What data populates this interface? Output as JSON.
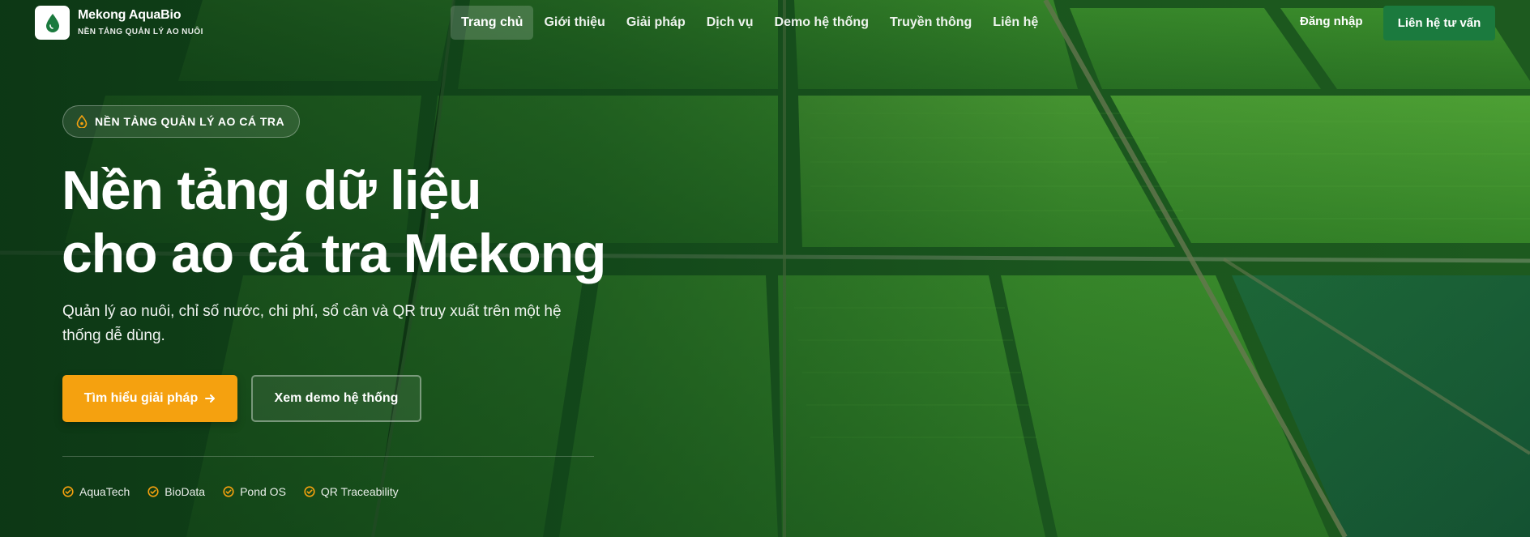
{
  "brand": {
    "name": "Mekong AquaBio",
    "tagline": "NỀN TẢNG QUẢN LÝ AO NUÔI",
    "logo_icon": "water-drop-icon"
  },
  "nav": {
    "items": [
      {
        "label": "Trang chủ",
        "active": true
      },
      {
        "label": "Giới thiệu"
      },
      {
        "label": "Giải pháp"
      },
      {
        "label": "Dịch vụ"
      },
      {
        "label": "Demo hệ thống"
      },
      {
        "label": "Truyền thông"
      },
      {
        "label": "Liên hệ"
      }
    ],
    "login_label": "Đăng nhập",
    "cta_label": "Liên hệ tư vấn"
  },
  "hero": {
    "badge": "NỀN TẢNG QUẢN LÝ AO CÁ TRA",
    "title_line1": "Nền tảng dữ liệu",
    "title_line2": "cho ao cá tra Mekong",
    "subtitle": "Quản lý ao nuôi, chỉ số nước, chi phí, sổ cân và QR truy xuất trên một hệ thống dễ dùng.",
    "primary_button": "Tìm hiểu giải pháp",
    "secondary_button": "Xem demo hệ thống",
    "features": [
      "AquaTech",
      "BioData",
      "Pond OS",
      "QR Traceability"
    ]
  },
  "colors": {
    "accent": "#f5a10f",
    "brand_green": "#1b7a3e",
    "background": "#0f4a1c"
  }
}
